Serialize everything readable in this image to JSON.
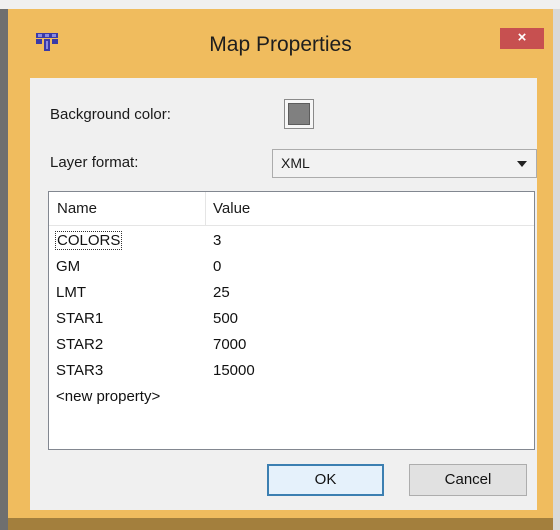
{
  "window": {
    "title": "Map Properties",
    "close_glyph": "×",
    "app_icon": "tiled-map-icon",
    "accent_color": "#f0bc5e",
    "close_color": "#c75050"
  },
  "form": {
    "background_color_label": "Background color:",
    "background_color_value": "#808080",
    "layer_format_label": "Layer format:",
    "layer_format_value": "XML"
  },
  "table": {
    "headers": [
      "Name",
      "Value"
    ],
    "rows": [
      {
        "name": "COLORS",
        "value": "3"
      },
      {
        "name": "GM",
        "value": "0"
      },
      {
        "name": "LMT",
        "value": "25"
      },
      {
        "name": "STAR1",
        "value": "500"
      },
      {
        "name": "STAR2",
        "value": "7000"
      },
      {
        "name": "STAR3",
        "value": "15000"
      }
    ],
    "new_property": "<new property>"
  },
  "buttons": {
    "ok": "OK",
    "cancel": "Cancel"
  }
}
